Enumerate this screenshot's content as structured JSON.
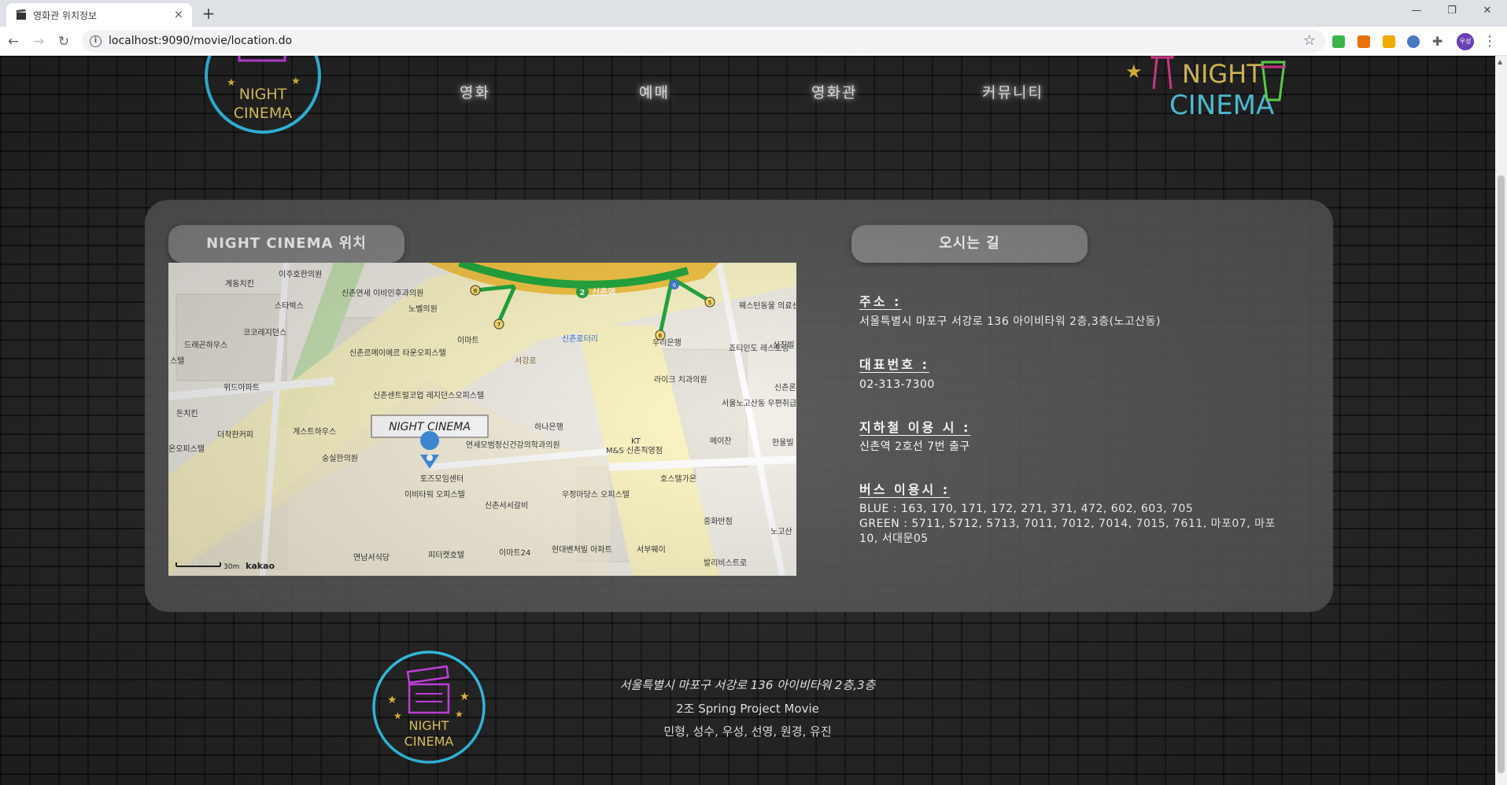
{
  "browser": {
    "tab_title": "영화관 위치정보",
    "tab_close": "×",
    "new_tab": "+",
    "url": "localhost:9090/movie/location.do",
    "profile_initials": "우성"
  },
  "header": {
    "logo_text_line1": "NIGHT",
    "logo_text_line2": "CINEMA",
    "nav": [
      {
        "label": "영화"
      },
      {
        "label": "예매"
      },
      {
        "label": "영화관"
      },
      {
        "label": "커뮤니티"
      }
    ],
    "right_logo_line1": "NIGHT",
    "right_logo_line2": "CINEMA"
  },
  "location_section": {
    "title": "NIGHT CINEMA 위치"
  },
  "directions_section": {
    "title": "오시는 길",
    "address_label": "주소 :",
    "address_value": "서울특별시 마포구 서강로 136 아이비타워 2층,3층(노고산동)",
    "phone_label": "대표번호 :",
    "phone_value": "02-313-7300",
    "subway_label": "지하철 이용 시 :",
    "subway_value": "신촌역 2호선 7번 출구",
    "bus_label": "버스 이용시 :",
    "bus_blue": "BLUE : 163, 170, 171, 172, 271, 371, 472, 602, 603, 705",
    "bus_green": "GREEN : 5711, 5712, 5713, 7011, 7012, 7014, 7015, 7611, 마포07, 마포10, 서대문05"
  },
  "map": {
    "marker_label": "NIGHT CINEMA",
    "station": "신촌역",
    "station_number": "2",
    "exit_numbers": [
      "8",
      "7",
      "6",
      "5",
      "6"
    ],
    "scale_text": "30m",
    "provider": "kakao",
    "colors": {
      "road": "#fdf6c3",
      "block": "#f2efe8",
      "park": "#c9e4b4",
      "subway": "#1fa83a",
      "ring": "#f5c542"
    },
    "labels": [
      "이주호한의원",
      "계동치킨",
      "신촌연세 이비인후과의원",
      "노벨의원",
      "스타벅스",
      "코코레지던스",
      "드래곤하우스",
      "이마트",
      "신촌로터리",
      "우리은행",
      "웨스턴동물 의료센터",
      "죠티인도 레스토랑",
      "삼진빌",
      "신촌르메이에르 타운오피스텔",
      "스텔",
      "위드아파트",
      "서강로",
      "라이크 치과의원",
      "신촌론",
      "신촌센트럴코업 레지던스오피스텔",
      "돈치킨",
      "서울노고산동 우편취급국",
      "게스트하우스",
      "더착한커피",
      "하나은행",
      "메이찬",
      "한울빌",
      "온오피스텔",
      "숭실한의원",
      "연세모범정신건강의학과의원",
      "M&S 신촌직영점",
      "KT",
      "토즈모임센터",
      "호스텔가온",
      "이비타워 오피스텔",
      "신촌서서갈비",
      "우정마당스 오피스텔",
      "중화반점",
      "노고산",
      "연남서식당",
      "피터캣호텔",
      "이마트24",
      "현대벤처빌 아파트",
      "서부웨이",
      "발리비스트로"
    ]
  },
  "footer": {
    "logo_line1": "NIGHT",
    "logo_line2": "CINEMA",
    "address": "서울특별시 마포구 서강로 136 아이비타워 2층,3층",
    "project": "2조 Spring Project Movie",
    "members": "민형, 성수, 우성, 선영, 원경, 유진"
  }
}
